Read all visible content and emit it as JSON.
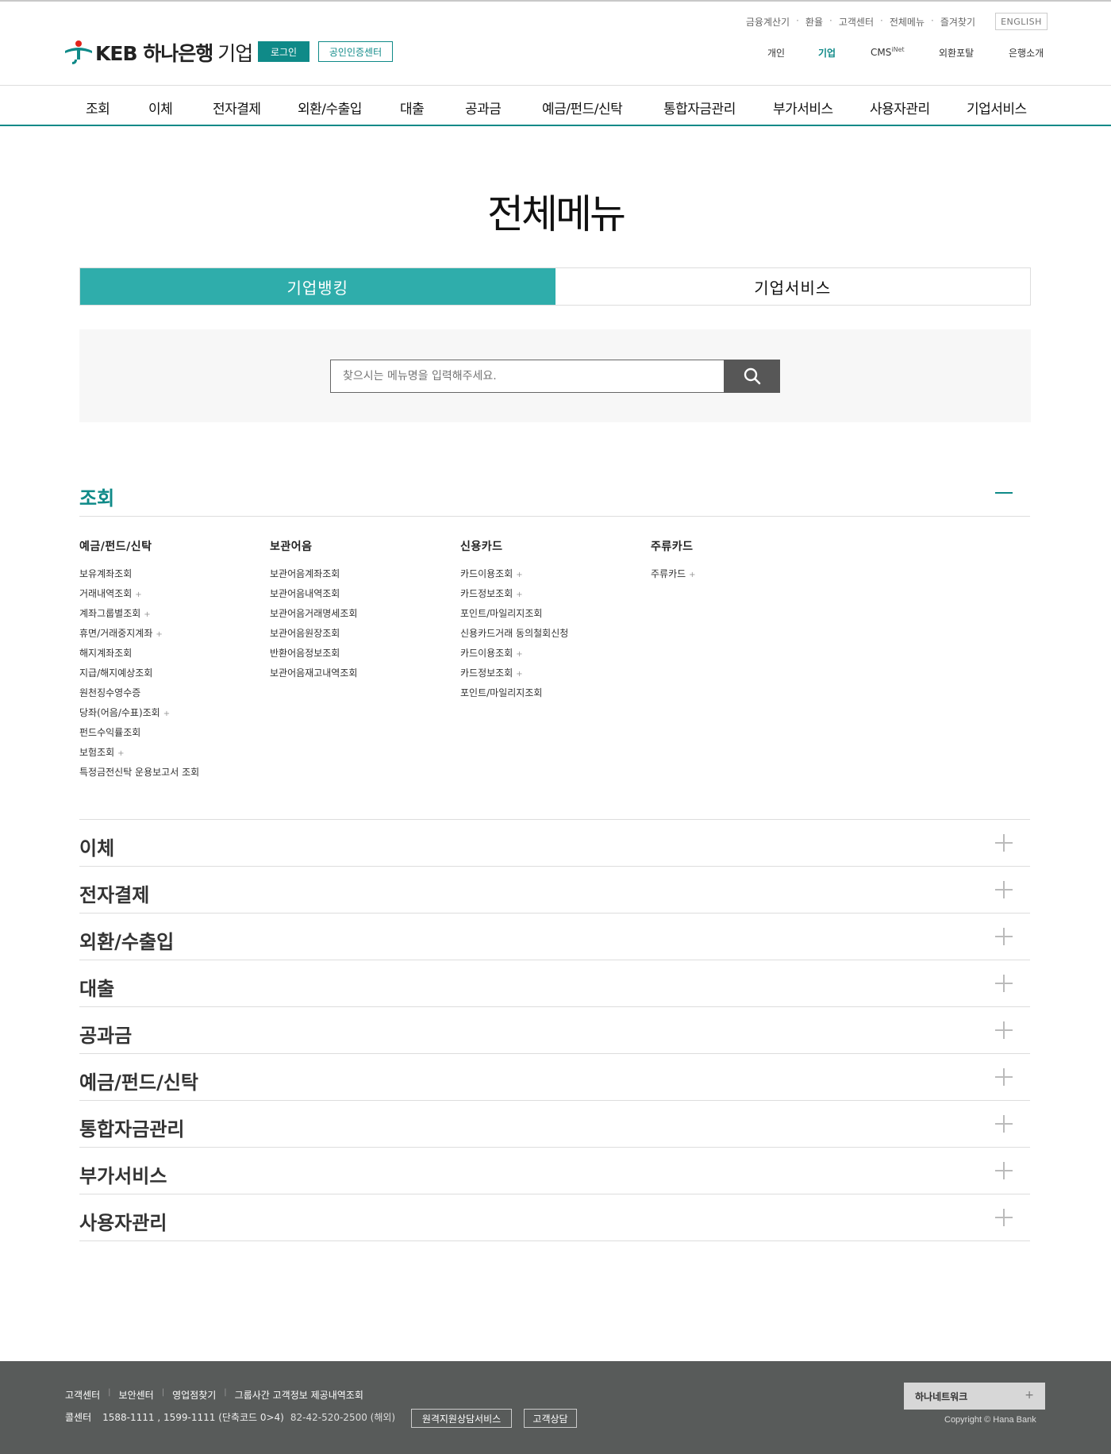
{
  "header": {
    "brand": "KEB 하나은행",
    "brand_sub": "기업",
    "login_label": "로그인",
    "cert_label": "공인인증센터",
    "util_links": [
      "금융계산기",
      "환율",
      "고객센터",
      "전체메뉴",
      "즐겨찾기"
    ],
    "english_label": "ENGLISH",
    "segments": {
      "personal": "개인",
      "corporate": "기업",
      "cms": "CMS",
      "cms_sup": "iNet",
      "fx_portal": "외환포탈",
      "bank_intro": "은행소개"
    },
    "active_segment": "기업"
  },
  "main_nav": [
    "조회",
    "이체",
    "전자결제",
    "외환/수출입",
    "대출",
    "공과금",
    "예금/펀드/신탁",
    "통합자금관리",
    "부가서비스",
    "사용자관리",
    "기업서비스"
  ],
  "page": {
    "title": "전체메뉴",
    "tabs": [
      "기업뱅킹",
      "기업서비스"
    ],
    "active_tab": "기업뱅킹"
  },
  "search": {
    "placeholder": "찾으시는 메뉴명을 입력해주세요.",
    "button_icon": "search-icon"
  },
  "sections": {
    "open": {
      "title": "조회",
      "columns": [
        {
          "heading": "예금/펀드/신탁",
          "items": [
            "보유계좌조회",
            "거래내역조회",
            "계좌그룹별조회",
            "휴면/거래중지계좌",
            "해지계좌조회",
            "지급/해지예상조회",
            "원천징수영수증",
            "당좌(어음/수표)조회",
            "펀드수익률조회",
            "보험조회",
            "특정금전신탁 운용보고서 조회"
          ],
          "expandable": [
            false,
            true,
            true,
            true,
            false,
            false,
            false,
            true,
            false,
            true,
            false
          ]
        },
        {
          "heading": "보관어음",
          "items": [
            "보관어음계좌조회",
            "보관어음내역조회",
            "보관어음거래명세조회",
            "보관어음원장조회",
            "반환어음정보조회",
            "보관어음재고내역조회"
          ],
          "expandable": [
            false,
            false,
            false,
            false,
            false,
            false
          ]
        },
        {
          "heading": "신용카드",
          "items": [
            "카드이용조회",
            "카드정보조회",
            "포인트/마일리지조회",
            "신용카드거래 동의철회신청",
            "카드이용조회",
            "카드정보조회",
            "포인트/마일리지조회"
          ],
          "expandable": [
            true,
            true,
            false,
            false,
            true,
            true,
            false
          ]
        },
        {
          "heading": "주류카드",
          "items": [
            "주류카드"
          ],
          "expandable": [
            true
          ]
        }
      ]
    },
    "collapsed": [
      "이체",
      "전자결제",
      "외환/수출입",
      "대출",
      "공과금",
      "예금/펀드/신탁",
      "통합자금관리",
      "부가서비스",
      "사용자관리"
    ]
  },
  "footer": {
    "links": [
      "고객센터",
      "보안센터",
      "영업점찾기",
      "그룹사간 고객정보 제공내역조회"
    ],
    "call_label": "콜센터",
    "call_numbers": "1588-1111 , 1599-1111 (단축코드 0>4)",
    "call_abroad": "82-42-520-2500 (해외)",
    "remote_btn": "원격지원상담서비스",
    "consult_btn": "고객상담",
    "family_label": "하나네트워크",
    "copyright": "Copyright © Hana Bank"
  },
  "colors": {
    "accent": "#0f8a88",
    "tab_active": "#2fadab",
    "footer_bg": "#585b5a"
  }
}
